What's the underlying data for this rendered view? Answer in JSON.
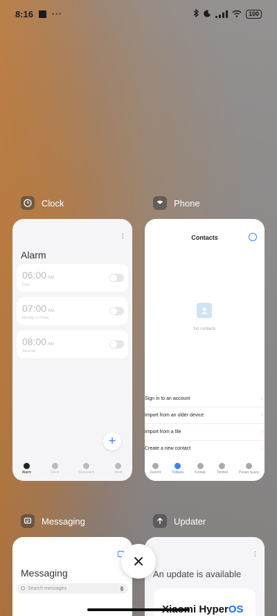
{
  "status_bar": {
    "time": "8:16",
    "battery": "100"
  },
  "recents": [
    {
      "app_name": "Clock",
      "screen": {
        "title": "Alarm",
        "alarms": [
          {
            "time": "06:00",
            "ampm": "AM",
            "sub": "Daily"
          },
          {
            "time": "07:00",
            "ampm": "AM",
            "sub": "Monday to Friday"
          },
          {
            "time": "08:00",
            "ampm": "AM",
            "sub": "Saturday"
          }
        ],
        "nav": [
          "Alarm",
          "Clock",
          "Stopwatch",
          "Timer"
        ],
        "nav_active": "Alarm"
      }
    },
    {
      "app_name": "Phone",
      "screen": {
        "title": "Contacts",
        "empty_text": "No contacts",
        "options": [
          "Sign in to an account",
          "Import from an older device",
          "Import from a file",
          "Create a new contact"
        ],
        "nav": [
          "Favorit",
          "Terbaru",
          "Kontak",
          "Tombol",
          "Pesan Suara"
        ],
        "nav_active": "Terbaru"
      }
    },
    {
      "app_name": "Messaging",
      "screen": {
        "title": "Messaging",
        "search_placeholder": "Search messages"
      }
    },
    {
      "app_name": "Updater",
      "screen": {
        "title": "An update is available",
        "brand": "Xiaomi Hyper",
        "brand_accent": "OS"
      }
    }
  ],
  "colors": {
    "accent": "#3b82f6"
  }
}
